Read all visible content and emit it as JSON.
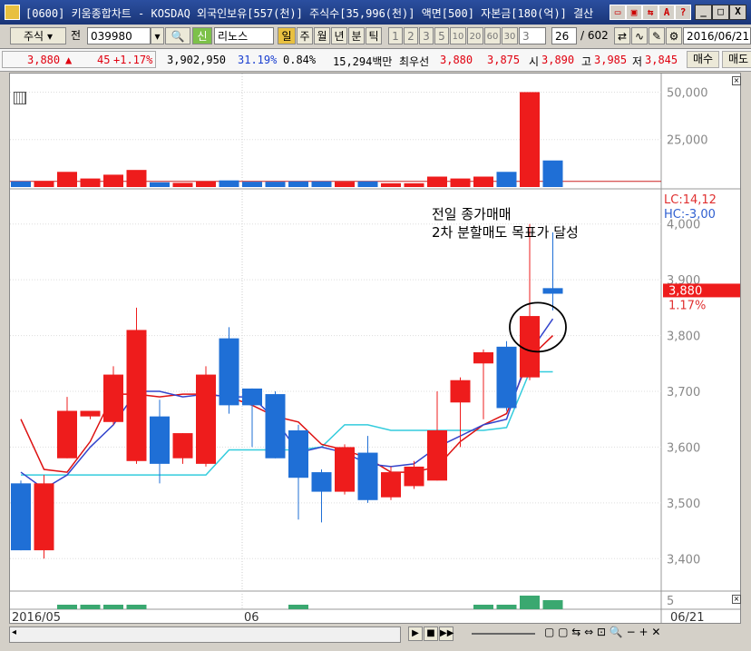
{
  "window": {
    "title": "[0600] 키움종합차트 - KOSDAQ 외국인보유[557(천)] 주식수[35,996(천)] 액면[500] 자본금[180(억)] 결산"
  },
  "toolbar": {
    "market_select": "주식",
    "prev_label": "전",
    "code": "039980",
    "credit_badge": "신",
    "stock_name": "리노스",
    "period_tabs": [
      "일",
      "주",
      "월",
      "년",
      "분",
      "틱"
    ],
    "period_numbers": [
      "1",
      "2",
      "3",
      "5",
      "10",
      "20",
      "60",
      "30",
      "3"
    ],
    "count_value": "26",
    "count_total": "/ 602",
    "date": "2016/06/21"
  },
  "quote": {
    "price": "3,880",
    "change_arrow": "▲",
    "change": "45",
    "change_pct": "+1.17%",
    "volume": "3,902,950",
    "ratio1": "31.19%",
    "ratio2": "0.84%",
    "amount": "15,294백만",
    "best_label": "최우선",
    "best_ask": "3,880",
    "best_bid": "3,875",
    "open_label": "시",
    "open": "3,890",
    "high_label": "고",
    "high": "3,985",
    "low_label": "저",
    "low": "3,845",
    "buy_button": "매수",
    "sell_button": "매도"
  },
  "annotation": {
    "line1": "전일 종가매매",
    "line2": "2차 분할매도 목표가 달성"
  },
  "price_panel": {
    "lc": "LC:14,12",
    "hc": "HC:-3,00",
    "current_price": "3,880",
    "current_pct": "1.17%",
    "axis_labels": [
      "4,000",
      "3,900",
      "3,800",
      "3,700",
      "3,600",
      "3,500",
      "3,400"
    ]
  },
  "volume_panel": {
    "axis_labels": [
      "50,000",
      "25,000"
    ]
  },
  "sub_panel": {
    "axis_label": "5"
  },
  "date_axis": {
    "labels": [
      "2016/05",
      "06",
      "06/21"
    ]
  },
  "chart_data": {
    "type": "candlestick",
    "x": [
      "c1",
      "c2",
      "c3",
      "c4",
      "c5",
      "c6",
      "c7",
      "c8",
      "c9",
      "c10",
      "c11",
      "c12",
      "c13",
      "c14",
      "c15",
      "c16",
      "c17",
      "c18",
      "c19",
      "c20",
      "c21",
      "c22",
      "c23",
      "c24"
    ],
    "open": [
      3535,
      3415,
      3580,
      3655,
      3645,
      3575,
      3655,
      3580,
      3570,
      3795,
      3705,
      3695,
      3630,
      3555,
      3520,
      3590,
      3510,
      3530,
      3540,
      3680,
      3750,
      3780,
      3725,
      3885
    ],
    "close": [
      3415,
      3535,
      3665,
      3665,
      3730,
      3810,
      3570,
      3625,
      3730,
      3675,
      3675,
      3580,
      3545,
      3520,
      3600,
      3505,
      3555,
      3565,
      3630,
      3720,
      3770,
      3670,
      3835,
      3875
    ],
    "high": [
      3540,
      3550,
      3690,
      3665,
      3745,
      3850,
      3685,
      3625,
      3745,
      3815,
      3705,
      3700,
      3640,
      3560,
      3605,
      3620,
      3565,
      3575,
      3700,
      3725,
      3775,
      3790,
      4000,
      3985
    ],
    "low": [
      3415,
      3400,
      3580,
      3650,
      3640,
      3570,
      3535,
      3570,
      3565,
      3660,
      3600,
      3580,
      3470,
      3465,
      3515,
      3500,
      3505,
      3525,
      3540,
      3600,
      3650,
      3665,
      3720,
      3845
    ],
    "volume": [
      3000,
      3200,
      8000,
      4500,
      6500,
      9000,
      2500,
      2200,
      3000,
      3500,
      2800,
      2800,
      3000,
      3000,
      2800,
      3000,
      2000,
      2000,
      5500,
      4500,
      5500,
      8000,
      50000,
      14000
    ],
    "ma_red": [
      3650,
      3560,
      3555,
      3610,
      3695,
      3695,
      3690,
      3695,
      3695,
      3690,
      3675,
      3655,
      3645,
      3605,
      3595,
      3580,
      3555,
      3555,
      3565,
      3610,
      3640,
      3660,
      3760,
      3800
    ],
    "ma_blue": [
      3555,
      3525,
      3550,
      3600,
      3640,
      3700,
      3700,
      3690,
      3695,
      3690,
      3690,
      3650,
      3590,
      3600,
      3590,
      3570,
      3565,
      3570,
      3600,
      3620,
      3640,
      3650,
      3770,
      3830
    ],
    "ma_cyan": [
      3550,
      3550,
      3550,
      3550,
      3550,
      3550,
      3550,
      3550,
      3550,
      3595,
      3595,
      3595,
      3595,
      3600,
      3640,
      3640,
      3630,
      3630,
      3630,
      3630,
      3630,
      3635,
      3735,
      3735
    ],
    "ylim": [
      3350,
      4050
    ],
    "volume_ylim": [
      0,
      55000
    ]
  },
  "colors": {
    "up": "#ee1c1c",
    "down": "#1f6fd6",
    "ma_red": "#dd1111",
    "ma_blue": "#3344cc",
    "ma_cyan": "#33ccdd"
  }
}
